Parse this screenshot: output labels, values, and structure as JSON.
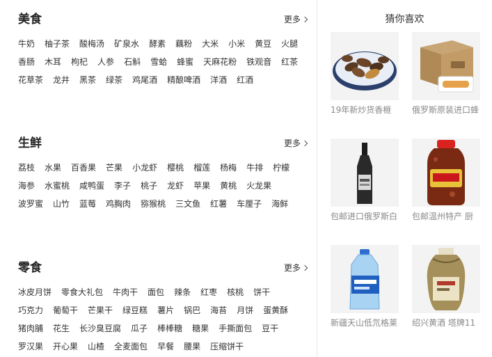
{
  "sections": [
    {
      "title": "美食",
      "more": "更多",
      "items": [
        "牛奶",
        "柚子茶",
        "酸梅汤",
        "矿泉水",
        "酵素",
        "藕粉",
        "大米",
        "小米",
        "黄豆",
        "火腿",
        "香肠",
        "木耳",
        "枸杞",
        "人参",
        "石斛",
        "雪蛤",
        "蜂蜜",
        "天麻花粉",
        "铁观音",
        "红茶",
        "花草茶",
        "龙井",
        "黑茶",
        "绿茶",
        "鸡尾酒",
        "精酿啤酒",
        "洋酒",
        "红酒"
      ]
    },
    {
      "title": "生鲜",
      "more": "更多",
      "items": [
        "荔枝",
        "水果",
        "百香果",
        "芒果",
        "小龙虾",
        "樱桃",
        "榴莲",
        "杨梅",
        "牛排",
        "柠檬",
        "海参",
        "水蜜桃",
        "咸鸭蛋",
        "李子",
        "桃子",
        "龙虾",
        "苹果",
        "黄桃",
        "火龙果",
        "波罗蜜",
        "山竹",
        "蓝莓",
        "鸡胸肉",
        "猕猴桃",
        "三文鱼",
        "红薯",
        "车厘子",
        "海鲜"
      ]
    },
    {
      "title": "零食",
      "more": "更多",
      "items": [
        "冰皮月饼",
        "零食大礼包",
        "牛肉干",
        "面包",
        "辣条",
        "红枣",
        "核桃",
        "饼干",
        "巧克力",
        "葡萄干",
        "芒果干",
        "绿豆糕",
        "薯片",
        "锅巴",
        "海苔",
        "月饼",
        "蛋黄酥",
        "猪肉脯",
        "花生",
        "长沙臭豆腐",
        "瓜子",
        "棒棒糖",
        "糖果",
        "手撕面包",
        "豆干",
        "罗汉果",
        "开心果",
        "山楂",
        "全麦面包",
        "早餐",
        "腰果",
        "压缩饼干"
      ]
    }
  ],
  "recommend": {
    "title": "猜你喜欢",
    "products": [
      {
        "caption": "19年新炒货香榧",
        "image": "roasted-nuts-bowl"
      },
      {
        "caption": "俄罗斯原装进口蜂",
        "image": "snack-box-carton"
      },
      {
        "caption": "包邮进口俄罗斯白",
        "image": "vodka-bottle"
      },
      {
        "caption": "包邮温州特产 厨",
        "image": "preserved-food-jar"
      },
      {
        "caption": "新疆天山低氘格莱",
        "image": "water-jug"
      },
      {
        "caption": "绍兴黄酒 塔牌11",
        "image": "rice-wine-jar"
      }
    ]
  }
}
